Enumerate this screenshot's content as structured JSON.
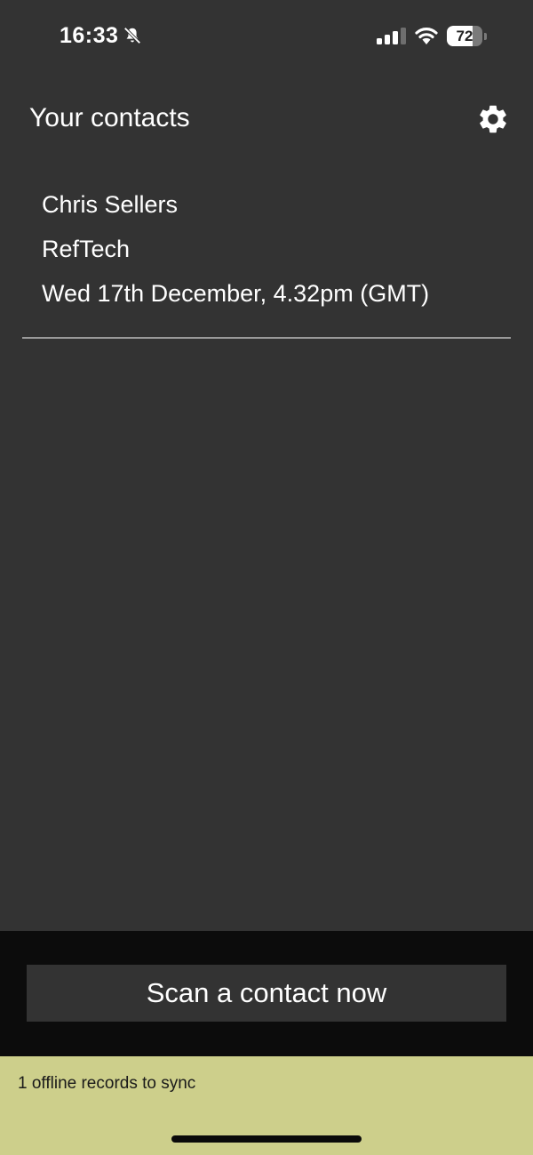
{
  "status_bar": {
    "time": "16:33",
    "battery_level": "72",
    "battery_fraction": 0.72,
    "signal_bars_active": 3,
    "signal_bars_total": 4
  },
  "header": {
    "title": "Your contacts",
    "settings_icon": "gear-icon"
  },
  "contacts": [
    {
      "name": "Chris Sellers",
      "company": "RefTech",
      "date": "Wed 17th December, 4.32pm (GMT)"
    }
  ],
  "actions": {
    "scan_label": "Scan a contact now"
  },
  "sync_banner": {
    "text": "1 offline records to sync"
  },
  "colors": {
    "background": "#333333",
    "action_bar": "#0c0c0c",
    "banner": "#cdcf8b",
    "divider": "#9a9a9a"
  }
}
